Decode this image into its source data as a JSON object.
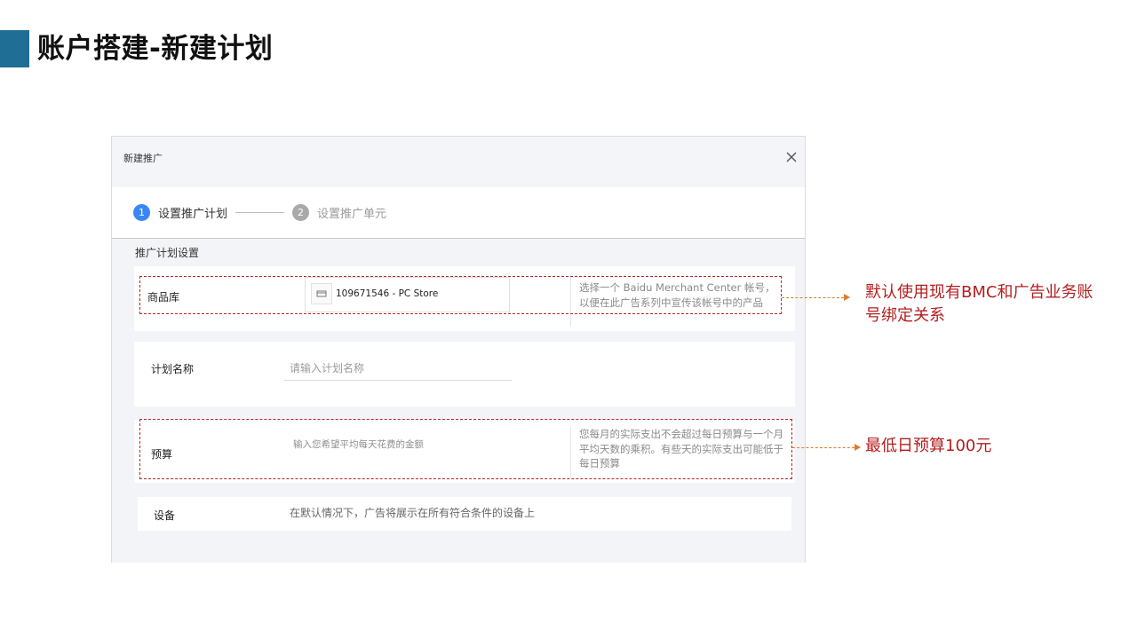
{
  "slide": {
    "title": "账户搭建-新建计划"
  },
  "dialog": {
    "title": "新建推广",
    "steps": [
      {
        "number": "1",
        "label": "设置推广计划"
      },
      {
        "number": "2",
        "label": "设置推广单元"
      }
    ],
    "section_title": "推广计划设置",
    "catalog": {
      "label": "商品库",
      "selected_store": "109671546 - PC Store",
      "description": "选择一个 Baidu Merchant Center 帐号，以便在此广告系列中宣传该帐号中的产品"
    },
    "plan_name": {
      "label": "计划名称",
      "placeholder": "请输入计划名称"
    },
    "budget": {
      "label": "预算",
      "placeholder": "输入您希望平均每天花费的金额",
      "description": "您每月的实际支出不会超过每日预算与一个月平均天数的乘积。有些天的实际支出可能低于每日预算"
    },
    "device": {
      "label": "设备",
      "description": "在默认情况下，广告将展示在所有符合条件的设备上"
    }
  },
  "callouts": {
    "catalog_note": "默认使用现有BMC和广告业务账号绑定关系",
    "budget_note": "最低日预算100元"
  },
  "colors": {
    "accent": "#1e6e96",
    "step_active": "#3b86f5",
    "callout_text": "#b41e1e",
    "arrow": "#e07b2e"
  }
}
